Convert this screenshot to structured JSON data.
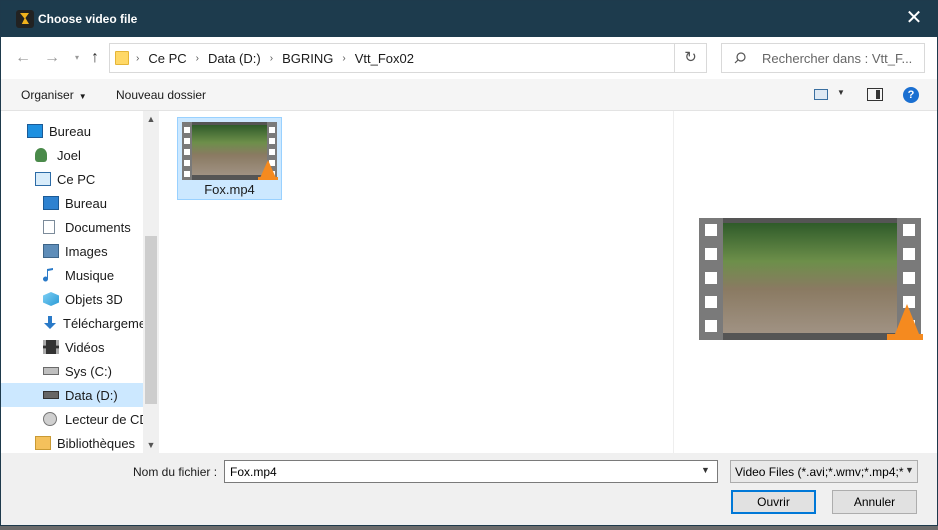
{
  "window": {
    "title": "Choose video file"
  },
  "address": {
    "crumbs": [
      "Ce PC",
      "Data (D:)",
      "BGRING",
      "Vtt_Fox02"
    ],
    "search_placeholder": "Rechercher dans : Vtt_F..."
  },
  "toolbar": {
    "organize_label": "Organiser",
    "new_folder_label": "Nouveau dossier"
  },
  "nav": {
    "items": [
      {
        "label": "Bureau",
        "icon": "desktop-icon"
      },
      {
        "label": "Joel",
        "icon": "user-icon"
      },
      {
        "label": "Ce PC",
        "icon": "computer-icon"
      },
      {
        "label": "Bureau",
        "icon": "desktop-icon"
      },
      {
        "label": "Documents",
        "icon": "documents-icon"
      },
      {
        "label": "Images",
        "icon": "pictures-icon"
      },
      {
        "label": "Musique",
        "icon": "music-icon"
      },
      {
        "label": "Objets 3D",
        "icon": "3d-objects-icon"
      },
      {
        "label": "Téléchargeme",
        "icon": "downloads-icon"
      },
      {
        "label": "Vidéos",
        "icon": "videos-icon"
      },
      {
        "label": "Sys (C:)",
        "icon": "drive-icon"
      },
      {
        "label": "Data (D:)",
        "icon": "drive-icon",
        "selected": true
      },
      {
        "label": "Lecteur de CD",
        "icon": "cd-drive-icon"
      },
      {
        "label": "Bibliothèques",
        "icon": "libraries-icon"
      }
    ]
  },
  "content": {
    "files": [
      {
        "name": "Fox.mp4",
        "icon": "video-thumbnail",
        "selected": true
      }
    ]
  },
  "footer": {
    "filename_label": "Nom du fichier :",
    "filename_value": "Fox.mp4",
    "filetype_value": "Video Files (*.avi;*.wmv;*.mp4;*",
    "open_label": "Ouvrir",
    "cancel_label": "Annuler"
  },
  "colors": {
    "titlebar": "#1d3b4d",
    "selection": "#cce8ff",
    "accent": "#0078d7"
  }
}
